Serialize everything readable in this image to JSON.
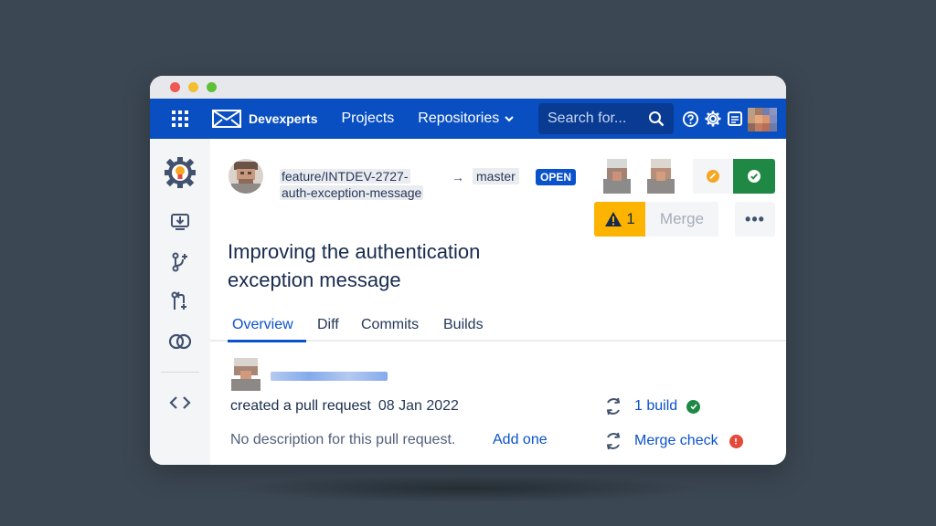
{
  "nav": {
    "brand": "Devexperts",
    "projects": "Projects",
    "repositories": "Repositories",
    "search_placeholder": "Search for..."
  },
  "pr": {
    "source_branch_line1": "feature/INTDEV-2727-",
    "source_branch_line2": "auth-exception-message",
    "arrow": "→",
    "target_branch": "master",
    "status": "OPEN",
    "title": "Improving the authentication exception message",
    "warning_count": "1",
    "merge_label": "Merge",
    "more_label": "•••"
  },
  "tabs": [
    {
      "label": "Overview"
    },
    {
      "label": "Diff"
    },
    {
      "label": "Commits"
    },
    {
      "label": "Builds"
    }
  ],
  "activity": {
    "created_text": "created a pull request",
    "created_date": "08 Jan 2022",
    "no_description": "No description for this pull request.",
    "add_one": "Add one"
  },
  "checks": [
    {
      "label": "1 build",
      "status": "success"
    },
    {
      "label": "Merge check",
      "status": "error"
    }
  ],
  "colors": {
    "nav_blue": "#0a4fc1",
    "link_blue": "#0a52cc",
    "success_green": "#1f8845",
    "warning_yellow": "#fcb400",
    "error_red": "#e5493a"
  }
}
